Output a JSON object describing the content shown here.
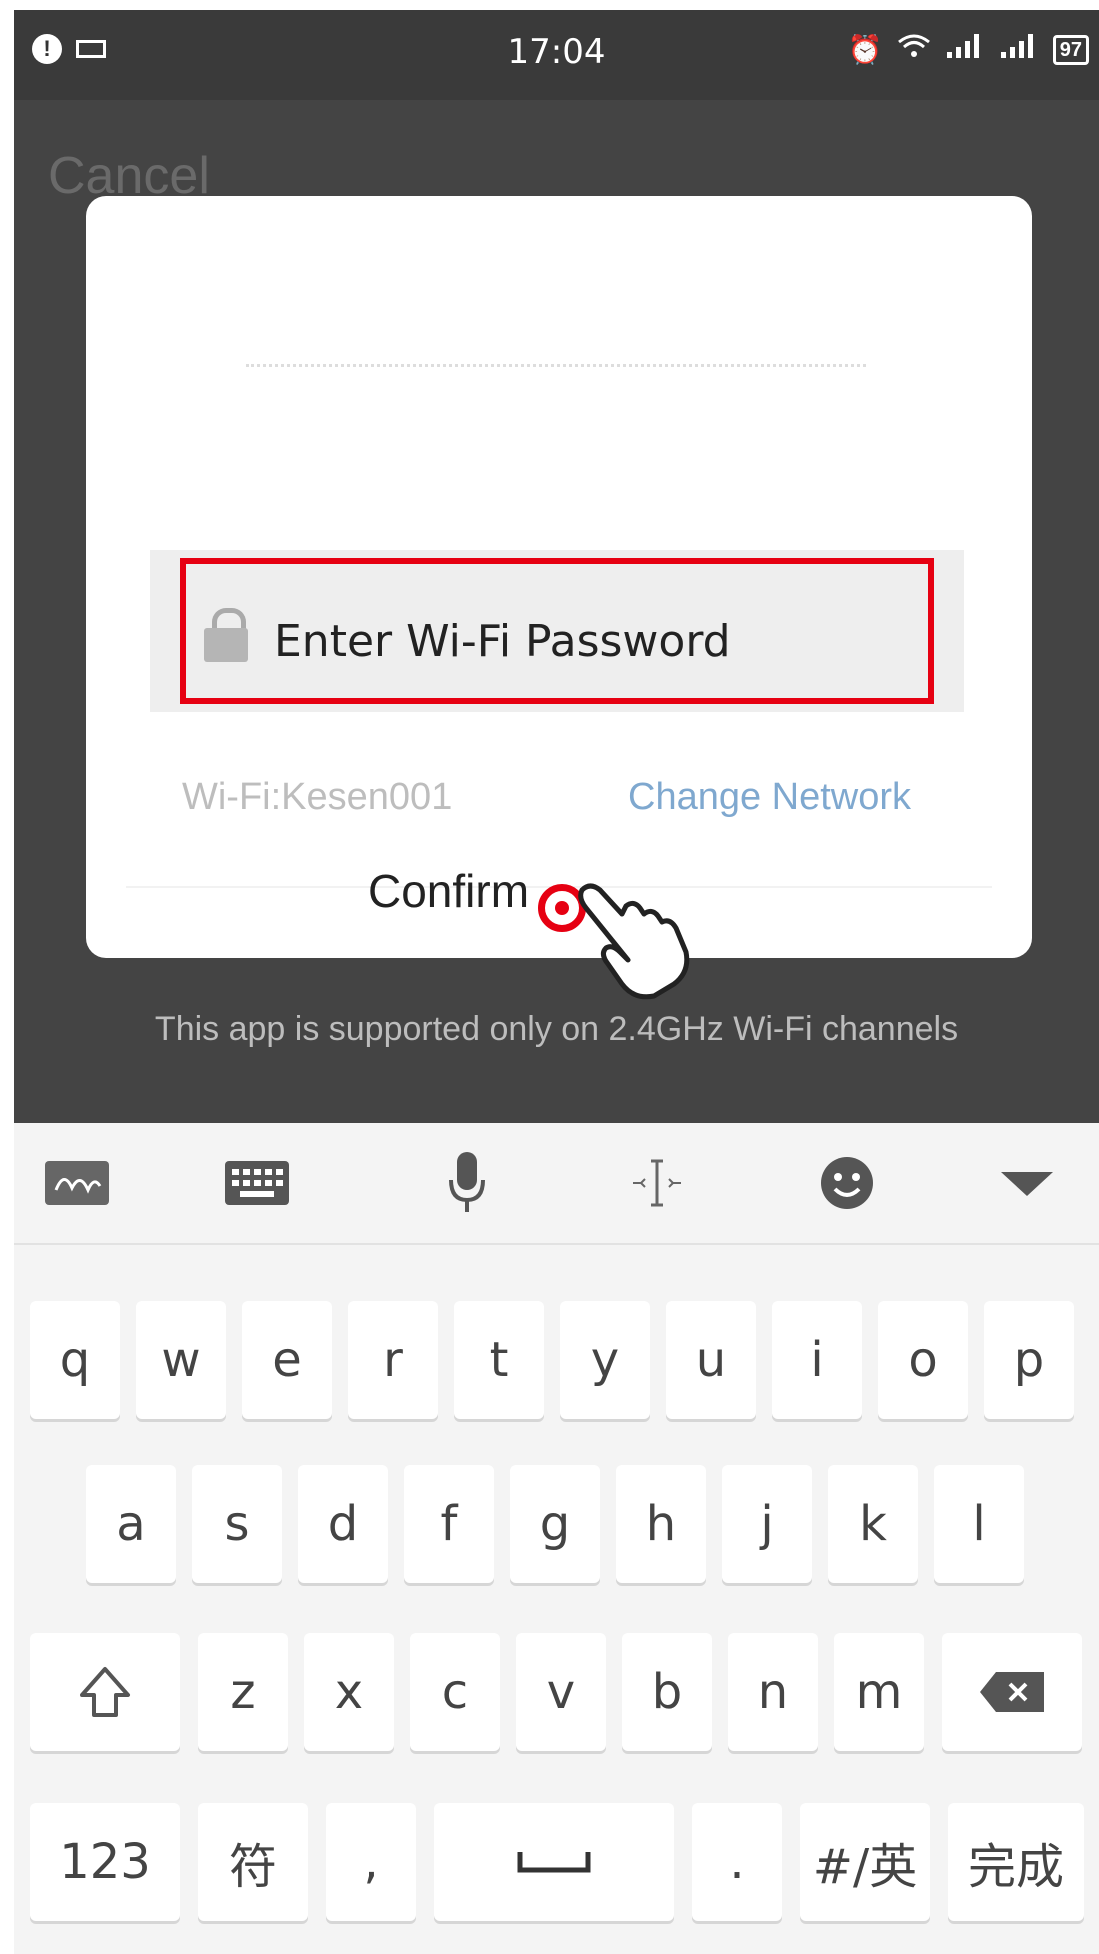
{
  "status_bar": {
    "time": "17:04",
    "info": "!",
    "battery": "97"
  },
  "header": {
    "cancel_label": "Cancel"
  },
  "dialog": {
    "password_placeholder": "Enter Wi-Fi Password",
    "wifi_label": "Wi-Fi:Kesen001",
    "change_network_label": "Change Network",
    "confirm_label": "Confirm"
  },
  "notice": "This app is supported only on 2.4GHz Wi-Fi channels",
  "keyboard": {
    "row1": [
      "q",
      "w",
      "e",
      "r",
      "t",
      "y",
      "u",
      "i",
      "o",
      "p"
    ],
    "row2": [
      "a",
      "s",
      "d",
      "f",
      "g",
      "h",
      "j",
      "k",
      "l"
    ],
    "row3": [
      "z",
      "x",
      "c",
      "v",
      "b",
      "n",
      "m"
    ],
    "row4": {
      "num": "123",
      "sym": "符",
      "comma": ",",
      "period": ".",
      "lang": "#/英",
      "done": "完成"
    },
    "toolbar_icons": [
      "handwriting-icon",
      "keyboard-icon",
      "microphone-icon",
      "cursor-icon",
      "emoji-icon",
      "collapse-icon"
    ],
    "accent_color": "#e60012"
  }
}
